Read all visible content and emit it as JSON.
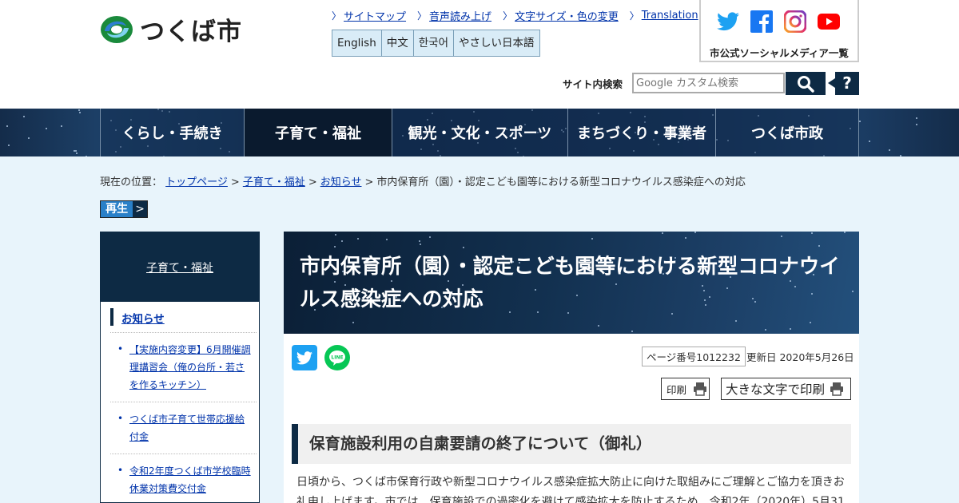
{
  "header": {
    "logo_text": "つくば市",
    "util_links": [
      "サイトマップ",
      "音声読み上げ",
      "文字サイズ・色の変更",
      "Translation"
    ],
    "languages": [
      "English",
      "中文",
      "한국어",
      "やさしい日本語"
    ],
    "sns_caption": "市公式ソーシャルメディア一覧",
    "sns_icons": [
      "twitter-icon",
      "facebook-icon",
      "instagram-icon",
      "youtube-icon"
    ],
    "search_label": "サイト内検索",
    "search_placeholder": "Google カスタム検索",
    "help_label": "?"
  },
  "gnav": {
    "items": [
      "くらし・手続き",
      "子育て・福祉",
      "観光・文化・スポーツ",
      "まちづくり・事業者",
      "つくば市政"
    ],
    "active_index": 1
  },
  "breadcrumb": {
    "prefix": "現在の位置：",
    "links": [
      "トップページ",
      "子育て・福祉",
      "お知らせ"
    ],
    "current": "市内保育所（園）・認定こども園等における新型コロナウイルス感染症への対応"
  },
  "play_button": {
    "label": "再生",
    "arrow": ">"
  },
  "side_nav": {
    "heading": "子育て・福祉",
    "subheading": "お知らせ",
    "items": [
      "【実施内容変更】6月開催調理講習会（俺の台所・若さを作るキッチン）",
      "つくば市子育て世帯応援給付金",
      "令和2年度つくば市学校臨時休業対策費交付金"
    ]
  },
  "main": {
    "title": "市内保育所（園）・認定こども園等における新型コロナウイルス感染症への対応",
    "page_number": "ページ番号1012232",
    "updated": "更新日 2020年5月26日",
    "print_label": "印刷",
    "print_big_label": "大きな文字で印刷",
    "section_heading": "保育施設利用の自粛要請の終了について（御礼）",
    "paragraph": "日頃から、つくば市保育行政や新型コロナウイルス感染症拡大防止に向けた取組みにご理解とご協力を頂きお礼申し上げます。市では、保育施設での過密化を避けて感染拡大を防止するため、令和2年（2020年）5月31"
  },
  "colors": {
    "navy": "#0d2a44",
    "link": "#0033aa",
    "page_bg": "#e8f4fb"
  }
}
